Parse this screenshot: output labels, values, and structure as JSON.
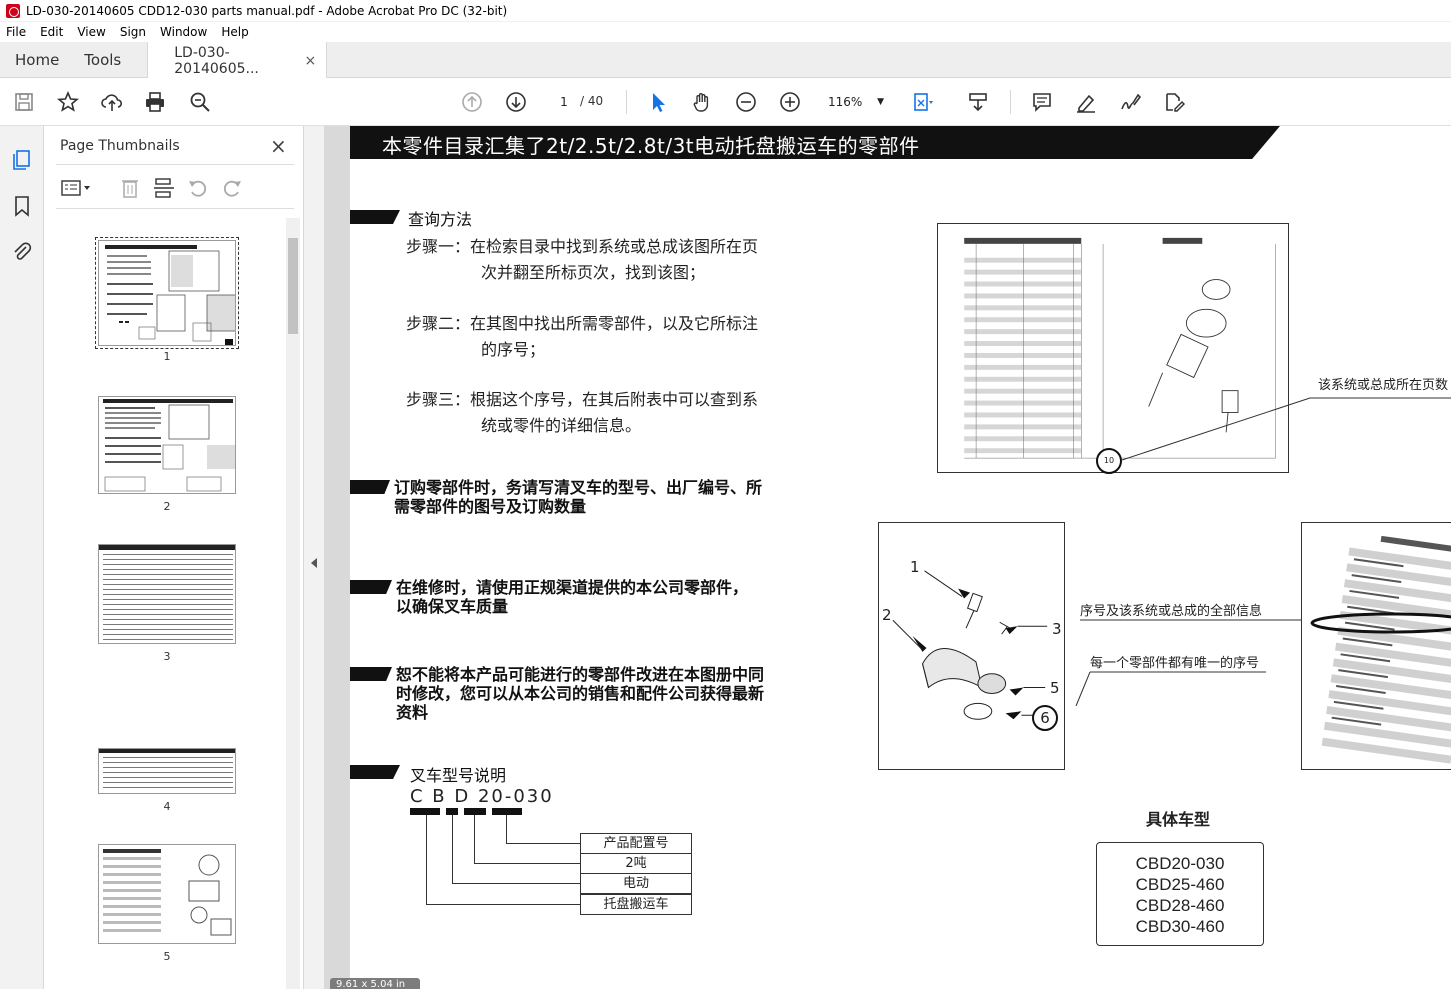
{
  "window": {
    "title": "LD-030-20140605 CDD12-030 parts manual.pdf - Adobe Acrobat Pro DC (32-bit)"
  },
  "menu": [
    "File",
    "Edit",
    "View",
    "Sign",
    "Window",
    "Help"
  ],
  "tabs": {
    "home": "Home",
    "tools": "Tools",
    "document": "LD-030-20140605...",
    "close": "×"
  },
  "toolbar": {
    "current_page": "1",
    "page_total": "/ 40",
    "zoom": "116%"
  },
  "panel": {
    "title": "Page Thumbnails",
    "close": "×",
    "thumbnails": [
      {
        "number": "1",
        "selected": true
      },
      {
        "number": "2",
        "selected": false
      },
      {
        "number": "3",
        "selected": false
      },
      {
        "number": "4",
        "selected": false
      },
      {
        "number": "5",
        "selected": false
      }
    ]
  },
  "document": {
    "header": "本零件目录汇集了2t/2.5t/2.8t/3t电动托盘搬运车的零部件",
    "query_title": "查询方法",
    "steps": [
      {
        "line1": "步骤一：在检索目录中找到系统或总成该图所在页",
        "line2": "次并翻至所标页次，找到该图；"
      },
      {
        "line1": "步骤二：在其图中找出所需零部件，以及它所标注",
        "line2": "的序号；"
      },
      {
        "line1": "步骤三：根据这个序号，在其后附表中可以查到系",
        "line2": "统或零件的详细信息。"
      }
    ],
    "notice_order": {
      "line1": "订购零部件时，务请写清叉车的型号、出厂编号、所",
      "line2": "需零部件的图号及订购数量"
    },
    "notice_genuine": {
      "line1": "在维修时，请使用正规渠道提供的本公司零部件，",
      "line2": "以确保叉车质量"
    },
    "notice_changes": {
      "line1": "恕不能将本产品可能进行的零部件改进在本图册中同",
      "line2": "时修改，您可以从本公司的销售和配件公司获得最新",
      "line3": "资料"
    },
    "model_title": "叉车型号说明",
    "model_code": "C B D 20-030",
    "model_labels": [
      "产品配置号",
      "2吨",
      "电动",
      "托盘搬运车"
    ],
    "annotations": {
      "page_location": "该系统或总成所在页数",
      "full_info": "序号及该系统或总成的全部信息",
      "unique_number": "每一个零部件都有唯一的序号"
    },
    "callouts": [
      "1",
      "2",
      "3",
      "5",
      "6"
    ],
    "sample_callout": "10",
    "specific_models_title": "具体车型",
    "specific_models": [
      "CBD20-030",
      "CBD25-460",
      "CBD28-460",
      "CBD30-460"
    ],
    "dims": "9.61 x 5.04 in"
  }
}
